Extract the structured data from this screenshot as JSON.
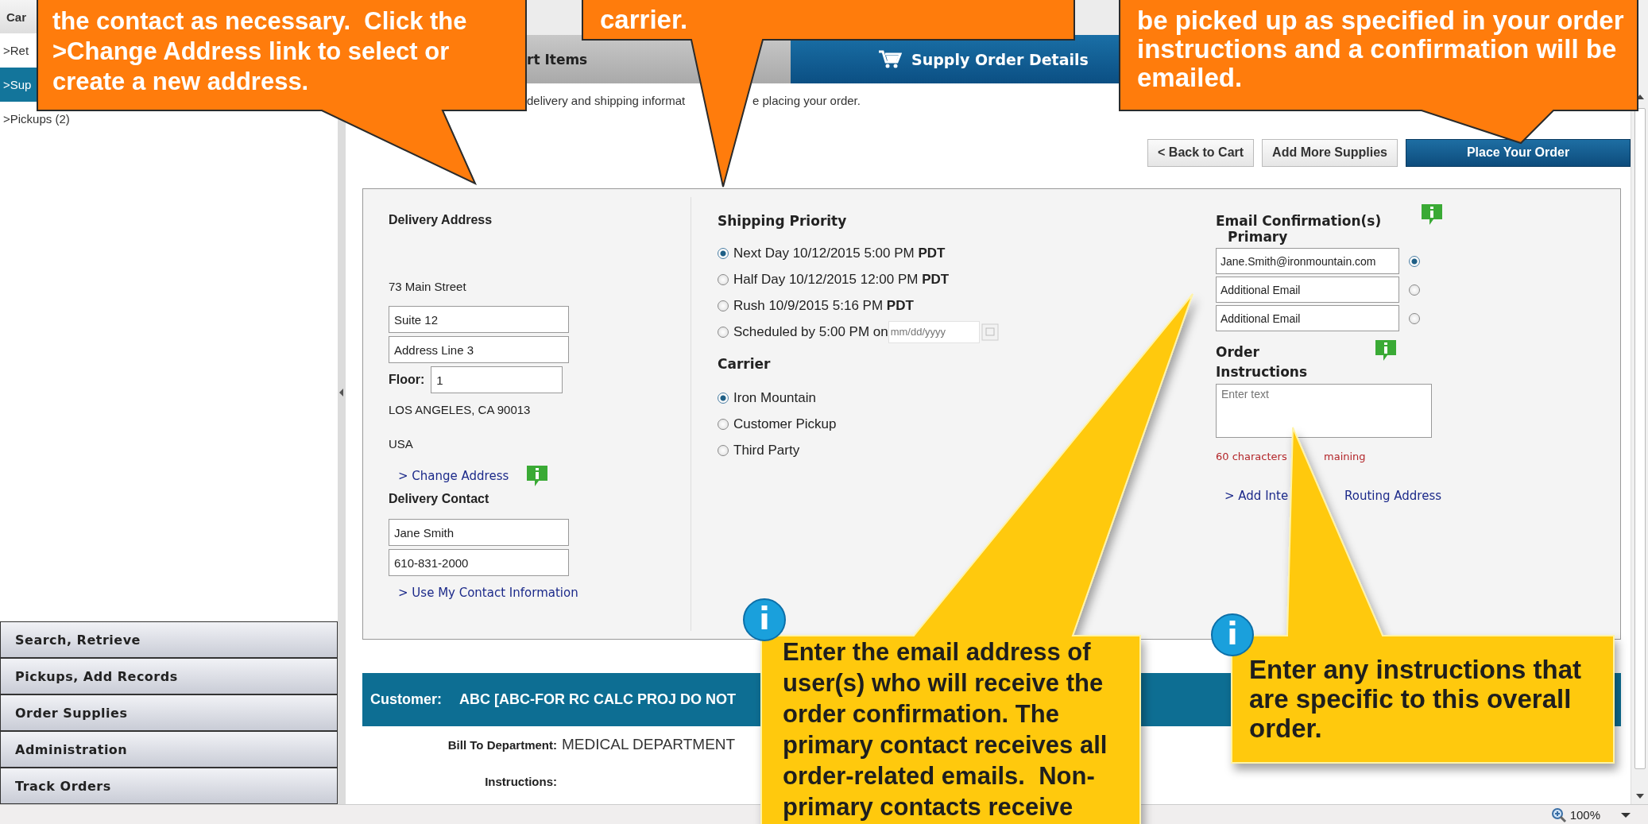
{
  "sidebar": {
    "header": "Car",
    "items": [
      {
        "label": ">Ret",
        "selected": false
      },
      {
        "label": ">Sup",
        "selected": true
      },
      {
        "label": ">Pickups (2)",
        "selected": false
      }
    ],
    "nav": [
      "Search, Retrieve",
      "Pickups, Add Records",
      "Order Supplies",
      "Administration",
      "Track Orders"
    ]
  },
  "header": {
    "tab": "rt Items",
    "title": "Supply Order Details"
  },
  "intro": [
    "delivery and shipping informat",
    "e placing your order."
  ],
  "buttons": [
    {
      "label": "< Back to Cart",
      "kind": "secondary"
    },
    {
      "label": "Add More Supplies",
      "kind": "secondary"
    },
    {
      "label": "Place Your Order",
      "kind": "primary"
    }
  ],
  "delivery": {
    "title": "Delivery Address",
    "street": "73 Main Street",
    "line2": "Suite 12",
    "line3": "Address Line 3",
    "floor_label": "Floor:",
    "floor": "1",
    "city": "LOS ANGELES, CA 90013",
    "country": "USA",
    "change_link": "> Change Address",
    "contact_title": "Delivery Contact",
    "contact_name": "Jane Smith",
    "contact_phone": "610-831-2000",
    "contact_link": "> Use My Contact Information"
  },
  "shipping": {
    "title": "Shipping Priority",
    "options": [
      {
        "kind": "plain",
        "label": "Next Day 10/12/2015 5:00 PM **PDT**",
        "selected": true
      },
      {
        "kind": "plain",
        "label": "Half Day 10/12/2015 12:00 PM **PDT**",
        "selected": false
      },
      {
        "kind": "plain",
        "label": "Rush 10/9/2015 5:16 PM **PDT**",
        "selected": false
      },
      {
        "kind": "date",
        "label": "Scheduled by 5:00 PM on",
        "placeholder": "mm/dd/yyyy",
        "selected": false
      }
    ]
  },
  "carrier": {
    "title": "Carrier",
    "options": [
      {
        "label": "Iron Mountain",
        "selected": true
      },
      {
        "label": "Customer Pickup",
        "selected": false
      },
      {
        "label": "Third Party",
        "selected": false
      }
    ]
  },
  "email": {
    "title": "Email Confirmation(s)",
    "subtitle": "Primary",
    "rows": [
      {
        "value": "Jane.Smith@ironmountain.com",
        "selected": true
      },
      {
        "value": "Additional Email",
        "selected": false
      },
      {
        "value": "Additional Email",
        "selected": false
      }
    ]
  },
  "instructions": {
    "title": "Order Instructions",
    "placeholder": "Enter text",
    "remaining": [
      "60 characters",
      "maining"
    ],
    "link": [
      "> Add Inte",
      "Routing Address"
    ]
  },
  "customer": {
    "label": "Customer:",
    "name": "ABC [ABC-FOR RC CALC PROJ DO NOT",
    "bill_label": "Bill To Department:",
    "bill_value": "MEDICAL DEPARTMENT",
    "instructions_label": "Instructions:"
  },
  "status_bar": {
    "zoom": "100%"
  },
  "callouts": [
    {
      "kind": "orange",
      "text": "the contact as necessary.  Click the >Change Address link to select or create a new address."
    },
    {
      "kind": "orange",
      "text": "carrier."
    },
    {
      "kind": "orange",
      "text": "be picked up as specified in your order instructions and a confirmation will be emailed."
    },
    {
      "kind": "yellow",
      "text": "Enter the email address of user(s) who will receive the order confirmation. The primary contact receives all order-related emails.  Non-primary contacts receive"
    },
    {
      "kind": "yellow",
      "text": "Enter any instructions that are specific to this overall order."
    }
  ]
}
